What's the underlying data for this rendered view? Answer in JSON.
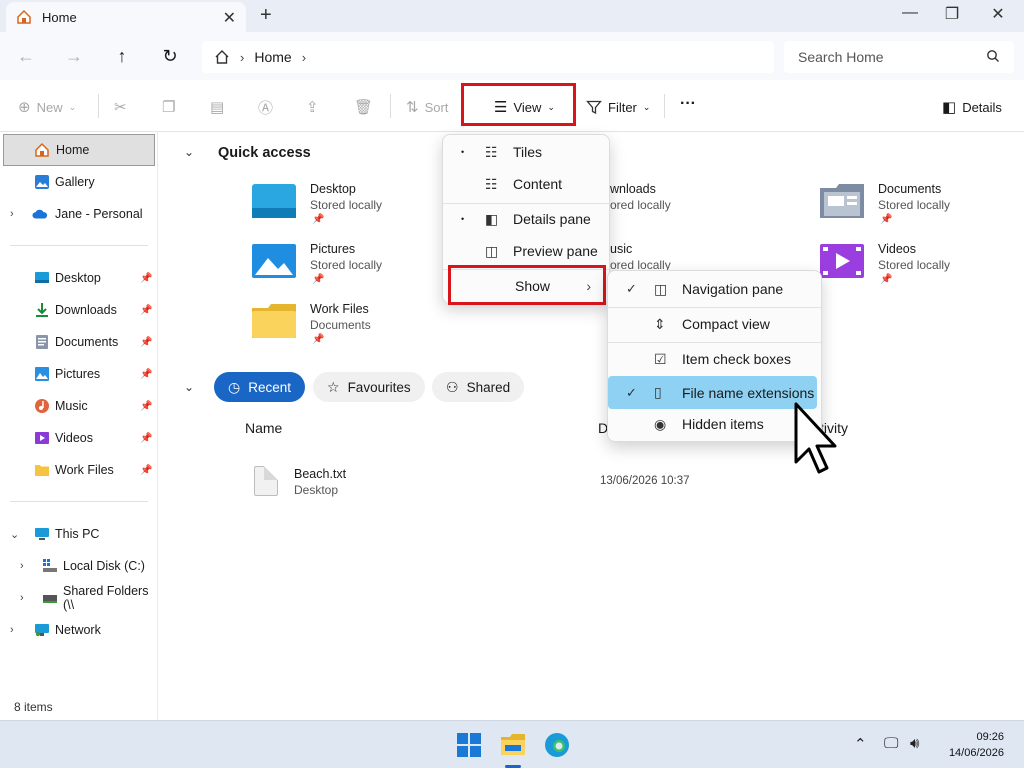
{
  "window": {
    "tab_title": "Home",
    "tab_close": "✕",
    "new_tab": "+",
    "minimize": "—",
    "maximize": "❐",
    "close": "✕"
  },
  "address": {
    "back": "←",
    "forward": "→",
    "up": "↑",
    "refresh": "↻",
    "crumbs": [
      "Home"
    ],
    "search_placeholder": "Search Home"
  },
  "commands": {
    "new": "New",
    "sort": "Sort",
    "view": "View",
    "filter": "Filter",
    "more": "···",
    "details": "Details"
  },
  "sidebar": {
    "top": [
      {
        "label": "Home",
        "selected": true
      },
      {
        "label": "Gallery"
      },
      {
        "label": "Jane - Personal"
      }
    ],
    "pinned": [
      {
        "label": "Desktop"
      },
      {
        "label": "Downloads"
      },
      {
        "label": "Documents"
      },
      {
        "label": "Pictures"
      },
      {
        "label": "Music"
      },
      {
        "label": "Videos"
      },
      {
        "label": "Work Files"
      }
    ],
    "tree": [
      {
        "label": "This PC"
      },
      {
        "label": "Local Disk (C:)"
      },
      {
        "label": "Shared Folders (\\\\"
      },
      {
        "label": "Network"
      }
    ],
    "status": "8 items"
  },
  "quick_access": {
    "title": "Quick access",
    "items": [
      {
        "name": "Desktop",
        "sub": "Stored locally"
      },
      {
        "name": "wnloads",
        "sub": "ored locally"
      },
      {
        "name": "Documents",
        "sub": "Stored locally"
      },
      {
        "name": "Pictures",
        "sub": "Stored locally"
      },
      {
        "name": "usic",
        "sub": "ored locally"
      },
      {
        "name": "Videos",
        "sub": "Stored locally"
      },
      {
        "name": "Work Files",
        "sub": "Documents"
      }
    ]
  },
  "recent": {
    "tabs": [
      "Recent",
      "Favourites",
      "Shared"
    ],
    "col_name": "Name",
    "col_date": "D",
    "col_activity": "tivity",
    "files": [
      {
        "name": "Beach.txt",
        "location": "Desktop",
        "date": "13/06/2026 10:37"
      }
    ]
  },
  "view_menu": {
    "items": [
      "Tiles",
      "Content",
      "Details pane",
      "Preview pane",
      "Show"
    ],
    "dot": "•",
    "arrow": "›"
  },
  "show_menu": {
    "check": "✓",
    "items": [
      "Navigation pane",
      "Compact view",
      "Item check boxes",
      "File name extensions",
      "Hidden items"
    ]
  },
  "taskbar": {
    "chevron": "⌃",
    "time": "09:26",
    "date": "14/06/2026"
  },
  "colors": {
    "accent": "#1a66c4",
    "highlight": "#8fd1f2",
    "annotation_red": "#d9151b"
  }
}
